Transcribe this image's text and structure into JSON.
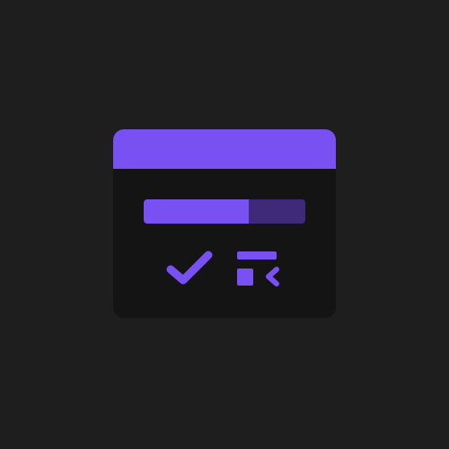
{
  "colors": {
    "background": "#1e1e1f",
    "window": "#141414",
    "accent": "#7950f2",
    "track": "#3e2a78"
  },
  "window": {
    "progress": {
      "value": 0.65
    },
    "icons": [
      "check-icon",
      "layout-icon"
    ]
  }
}
